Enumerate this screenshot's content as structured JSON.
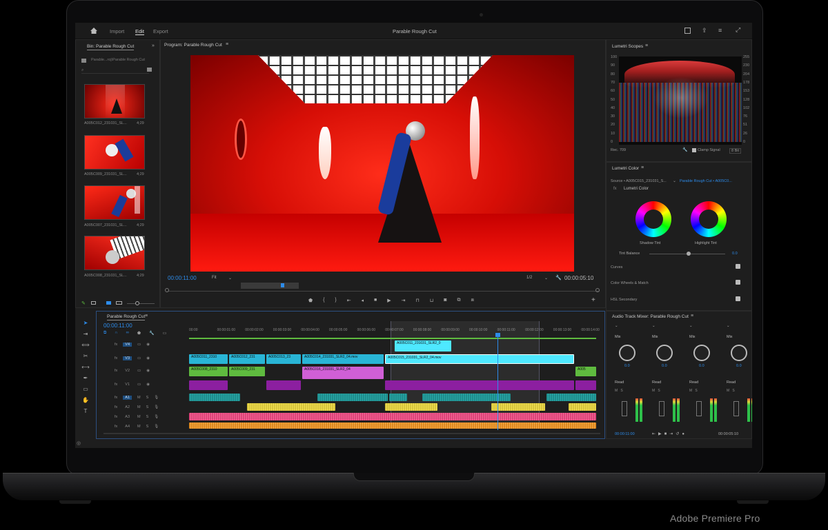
{
  "app": {
    "title": "Parable Rough Cut",
    "nav": [
      "Import",
      "Edit",
      "Export"
    ],
    "active_nav": "Edit"
  },
  "bin": {
    "tab": "Bin: Parable Rough Cut",
    "path": "Parable...roj\\Parable Rough Cut",
    "items": [
      {
        "name": "A005C012_231031_SL...",
        "dur": "4;29"
      },
      {
        "name": "A005C009_231031_SL...",
        "dur": "4;29"
      },
      {
        "name": "A005C007_231031_SL...",
        "dur": "4;29"
      },
      {
        "name": "A005C008_231031_SL...",
        "dur": "4;29"
      }
    ]
  },
  "program": {
    "tab": "Program: Parable Rough Cut",
    "timecode": "00:00:11:00",
    "fit": "Fit",
    "resolution": "1/2",
    "duration": "00:00:05:10"
  },
  "scopes": {
    "tab": "Lumetri Scopes",
    "left_scale": [
      "100",
      "90",
      "80",
      "70",
      "60",
      "50",
      "40",
      "30",
      "20",
      "10",
      "0"
    ],
    "right_scale": [
      "255",
      "230",
      "204",
      "178",
      "153",
      "128",
      "102",
      "76",
      "51",
      "26",
      "0"
    ],
    "standard": "Rec. 709",
    "clamp": "Clamp Signal",
    "bit": "8 Bit"
  },
  "lumetri": {
    "tab": "Lumetri Color",
    "source": "Source • A005C015_231031_S...",
    "target": "Parable Rough Cut • A005C0...",
    "effect": "Lumetri Color",
    "shadow": "Shadow Tint",
    "highlight": "Highlight Tint",
    "tint_balance": "Tint Balance",
    "tint_value": "0.0",
    "sections": [
      "Curves",
      "Color Wheels & Match",
      "HSL Secondary"
    ]
  },
  "mixer": {
    "tab": "Audio Track Mixer: Parable Rough Cut",
    "mode": "Mix",
    "read": "Read",
    "value": "0.0",
    "timecode": "00:00:11:00",
    "end": "00:00:05:10"
  },
  "timeline": {
    "tab": "Parable Rough Cut",
    "timecode": "00:00:11:00",
    "ticks": [
      "00:00",
      "00:00:01:00",
      "00:00:02:00",
      "00:00:03:00",
      "00:00:04:00",
      "00:00:05:00",
      "00:00:06:00",
      "00:00:07:00",
      "00:00:08:00",
      "00:00:09:00",
      "00:00:10:00",
      "00:00:11:00",
      "00:00:12:00",
      "00:00:13:00",
      "00:00:14:00"
    ],
    "video_tracks": [
      "V4",
      "V3",
      "V2",
      "V1"
    ],
    "audio_tracks": [
      "A1",
      "A2",
      "A3",
      "A4"
    ],
    "clips": {
      "v4": "A005C011_231031_SLR2_0",
      "v3a": "A005C011_2310",
      "v3b": "A005C012_231",
      "v3c": "A005C013_23",
      "v3d": "A005C014_231031_SLR2_04.mov",
      "v3e": "A005C015_231031_SLR2_04.mov",
      "v2a": "A005C008_2310",
      "v2b": "A005C009_231",
      "v2c": "A005C016_231031_SLR2_04",
      "v2d": "A005"
    }
  },
  "colors": {
    "accent": "#2d8ceb",
    "v_cyan": "#29b5d6",
    "v_green": "#5fbb3f",
    "v_pink": "#d05fd6",
    "v_purple": "#8c1fa0",
    "a_teal": "#1f8c8c",
    "a_yellow": "#d8c53a",
    "a_pink": "#e0427a",
    "a_orange": "#e08a1f"
  },
  "caption": "Adobe Premiere Pro"
}
